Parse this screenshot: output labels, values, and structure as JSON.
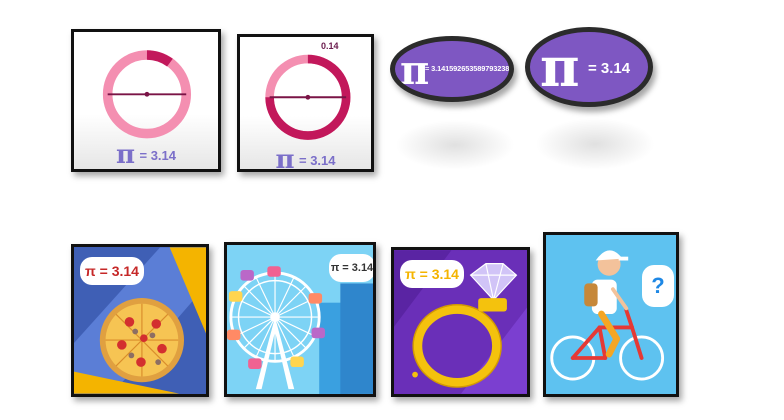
{
  "tiles": {
    "circle_1": {
      "pi_symbol": "π",
      "pi_value_text": "= 3.14"
    },
    "circle_2": {
      "pi_symbol": "π",
      "pi_value_text": "= 3.14",
      "arc_value": "0.14"
    },
    "oval_1": {
      "pi_symbol": "π",
      "digits": "= 3.14159265358979323846"
    },
    "oval_2": {
      "pi_symbol": "π",
      "value_text": "= 3.14"
    },
    "pizza": {
      "bubble_text": "π = 3.14"
    },
    "ferris_wheel": {
      "bubble_text": "π = 3.14"
    },
    "ring": {
      "bubble_text": "π = 3.14"
    },
    "bicycle": {
      "bubble_text": "?"
    }
  },
  "colors": {
    "circle_pink_light": "#f48fb1",
    "circle_pink_dark": "#c2185b",
    "pi_label": "#7b6fc9",
    "oval_purple": "#7e57c2",
    "bubble_red": "#c62828",
    "ring_gold": "#f4c20d",
    "bicycle_question": "#1e88e5"
  },
  "icons": [
    "pizza-icon",
    "ferris-wheel-icon",
    "diamond-ring-icon",
    "cyclist-icon"
  ]
}
